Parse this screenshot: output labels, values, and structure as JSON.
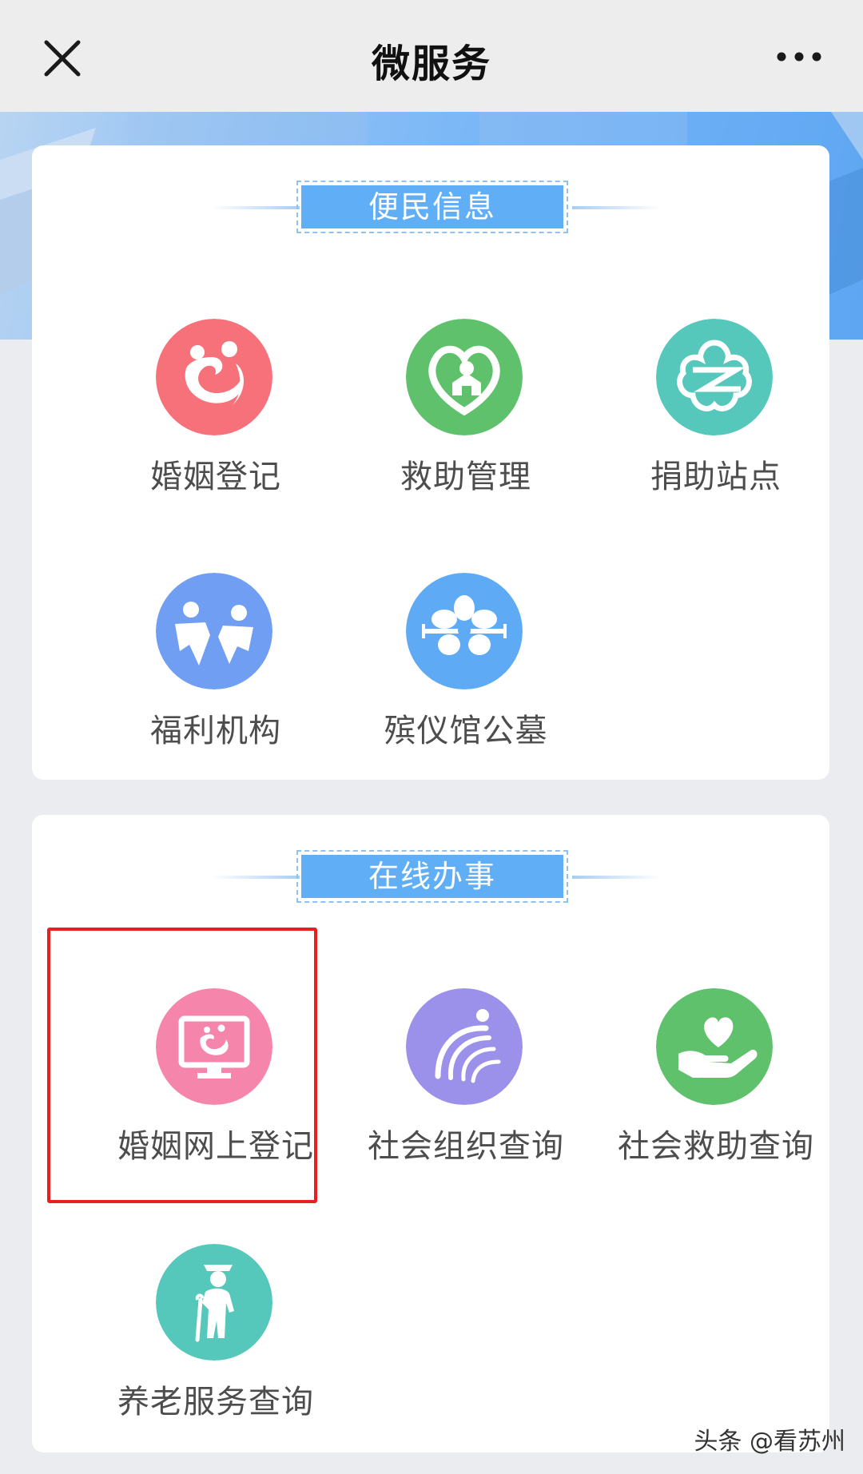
{
  "nav": {
    "title": "微服务",
    "close_icon": "close-icon",
    "more_icon": "more-icon"
  },
  "sections": [
    {
      "title": "便民信息",
      "items": [
        {
          "label": "婚姻登记",
          "icon": "marriage-icon",
          "color": "#f7717a"
        },
        {
          "label": "救助管理",
          "icon": "relief-icon",
          "color": "#5fc16b"
        },
        {
          "label": "捐助站点",
          "icon": "donation-icon",
          "color": "#56c7bb"
        },
        {
          "label": "福利机构",
          "icon": "welfare-icon",
          "color": "#6f9ef3"
        },
        {
          "label": "殡仪馆公墓",
          "icon": "funeral-icon",
          "color": "#5eaaf5"
        }
      ]
    },
    {
      "title": "在线办事",
      "items": [
        {
          "label": "婚姻网上登记",
          "icon": "online-marriage-icon",
          "color": "#f685ac"
        },
        {
          "label": "社会组织查询",
          "icon": "social-org-icon",
          "color": "#9b90ea"
        },
        {
          "label": "社会救助查询",
          "icon": "social-relief-icon",
          "color": "#5fc16b"
        },
        {
          "label": "养老服务查询",
          "icon": "elderly-icon",
          "color": "#56c7bb"
        }
      ]
    }
  ],
  "highlight_color": "#e8201d",
  "watermark": "头条 @看苏州"
}
